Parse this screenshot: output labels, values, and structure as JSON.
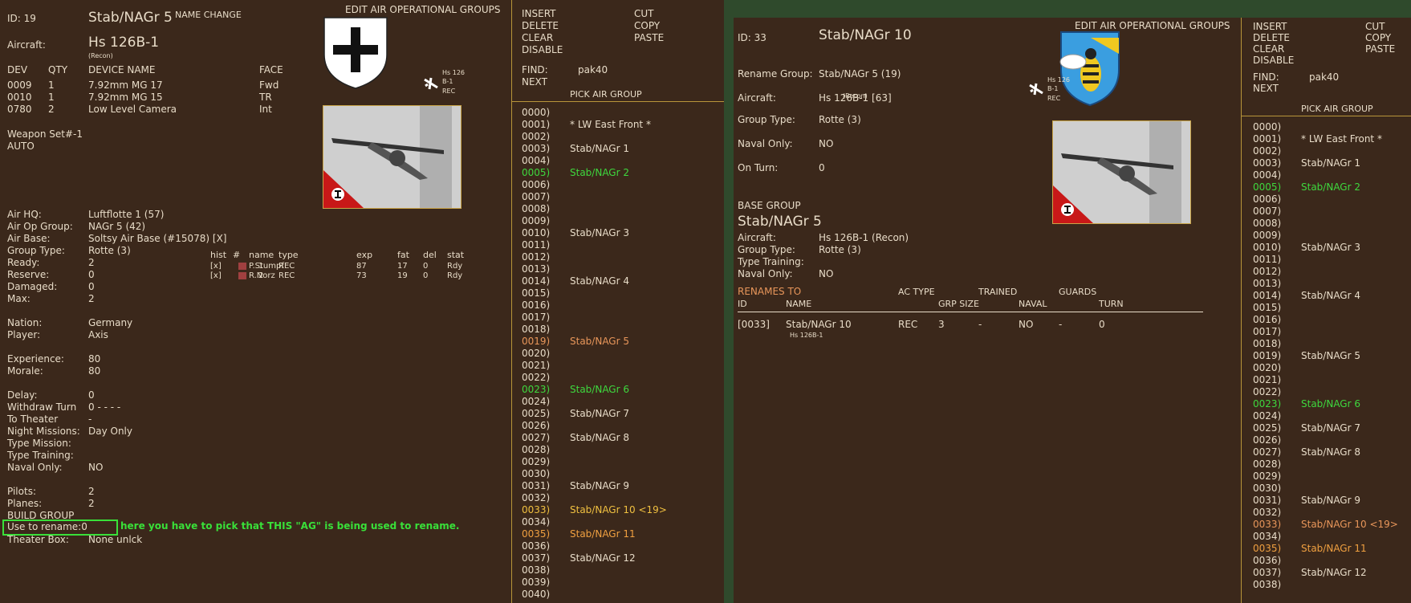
{
  "left": {
    "id": "ID: 19",
    "group_name": "Stab/NAGr 5",
    "name_change": "NAME CHANGE",
    "title": "EDIT AIR OPERATIONAL GROUPS",
    "aircraft_label": "Aircraft:",
    "aircraft": "Hs 126B-1",
    "aircraft_role": "(Recon)",
    "plane_tag1": "Hs 126",
    "plane_tag2": "B-1",
    "plane_tag3": "REC",
    "dev_headers": [
      "DEV",
      "QTY",
      "DEVICE NAME",
      "FACE"
    ],
    "devices": [
      [
        "0009",
        "1",
        "7.92mm MG 17",
        "Fwd"
      ],
      [
        "0010",
        "1",
        "7.92mm MG 15",
        "TR"
      ],
      [
        "0780",
        "2",
        "Low Level Camera",
        "Int"
      ]
    ],
    "weapon_set": "Weapon Set#-1",
    "weapon_mode": "AUTO",
    "info": [
      [
        "Air HQ:",
        "Luftflotte 1 (57)"
      ],
      [
        "Air Op Group:",
        "NAGr 5 (42)"
      ],
      [
        "Air Base:",
        "Soltsy Air Base (#15078)  [X]"
      ],
      [
        "Group Type:",
        "Rotte (3)"
      ],
      [
        "Ready:",
        "2"
      ],
      [
        "Reserve:",
        "0"
      ],
      [
        "Damaged:",
        "0"
      ],
      [
        "Max:",
        "2"
      ]
    ],
    "nation": [
      [
        "Nation:",
        "Germany"
      ],
      [
        "Player:",
        "Axis"
      ]
    ],
    "exp": [
      [
        "Experience:",
        "80"
      ],
      [
        "Morale:",
        "80"
      ]
    ],
    "timing": [
      [
        "Delay:",
        "0"
      ],
      [
        "Withdraw Turn",
        "0      -       -       -       -"
      ],
      [
        "To Theater",
        "-"
      ],
      [
        "Night Missions:",
        "Day Only"
      ],
      [
        "Type Mission:",
        ""
      ],
      [
        "Type Training:",
        ""
      ],
      [
        "Naval Only:",
        "NO"
      ]
    ],
    "pilots": [
      [
        "Pilots:",
        "2"
      ],
      [
        "Planes:",
        "2"
      ]
    ],
    "build_group": "BUILD GROUP",
    "use_to_rename": "Use to rename:0",
    "rename_hint": "here you have to pick that THIS \"AG\" is being used to rename.",
    "theater_box": "Theater Box:",
    "theater_val": "None    unlck",
    "pilot_headers": [
      "hist",
      "#",
      "name",
      "type",
      "exp",
      "fat",
      "del",
      "stat"
    ],
    "pilots_table": [
      [
        "[x]",
        "1",
        "P.Stumpf",
        "REC",
        "87",
        "17",
        "0",
        "Rdy"
      ],
      [
        "[x]",
        "2",
        "R.Norz",
        "REC",
        "73",
        "19",
        "0",
        "Rdy"
      ]
    ]
  },
  "menu_left": {
    "insert": "INSERT",
    "delete": "DELETE",
    "clear": "CLEAR",
    "disable": "DISABLE",
    "cut": "CUT",
    "copy": "COPY",
    "paste": "PASTE",
    "find_label": "FIND:",
    "find_value": "pak40",
    "next": "NEXT",
    "pick_title": "PICK AIR GROUP"
  },
  "list_left": [
    {
      "code": "0000)",
      "name": "",
      "color": "#e8dcc8"
    },
    {
      "code": "0001)",
      "name": "* LW East Front *",
      "color": "#e8dcc8"
    },
    {
      "code": "0002)",
      "name": "",
      "color": "#e8dcc8"
    },
    {
      "code": "0003)",
      "name": "Stab/NAGr 1",
      "color": "#e8dcc8"
    },
    {
      "code": "0004)",
      "name": "",
      "color": "#e8dcc8"
    },
    {
      "code": "0005)",
      "name": "Stab/NAGr 2",
      "color": "#3ed83e"
    },
    {
      "code": "0006)",
      "name": "",
      "color": "#e8dcc8"
    },
    {
      "code": "0007)",
      "name": "",
      "color": "#e8dcc8"
    },
    {
      "code": "0008)",
      "name": "",
      "color": "#e8dcc8"
    },
    {
      "code": "0009)",
      "name": "",
      "color": "#e8dcc8"
    },
    {
      "code": "0010)",
      "name": "Stab/NAGr 3",
      "color": "#e8dcc8"
    },
    {
      "code": "0011)",
      "name": "",
      "color": "#e8dcc8"
    },
    {
      "code": "0012)",
      "name": "",
      "color": "#e8dcc8"
    },
    {
      "code": "0013)",
      "name": "",
      "color": "#e8dcc8"
    },
    {
      "code": "0014)",
      "name": "Stab/NAGr 4",
      "color": "#e8dcc8"
    },
    {
      "code": "0015)",
      "name": "",
      "color": "#e8dcc8"
    },
    {
      "code": "0016)",
      "name": "",
      "color": "#e8dcc8"
    },
    {
      "code": "0017)",
      "name": "",
      "color": "#e8dcc8"
    },
    {
      "code": "0018)",
      "name": "",
      "color": "#e8dcc8"
    },
    {
      "code": "0019)",
      "name": "Stab/NAGr 5",
      "color": "#e8965a"
    },
    {
      "code": "0020)",
      "name": "",
      "color": "#e8dcc8"
    },
    {
      "code": "0021)",
      "name": "",
      "color": "#e8dcc8"
    },
    {
      "code": "0022)",
      "name": "",
      "color": "#e8dcc8"
    },
    {
      "code": "0023)",
      "name": "Stab/NAGr 6",
      "color": "#3ed83e"
    },
    {
      "code": "0024)",
      "name": "",
      "color": "#e8dcc8"
    },
    {
      "code": "0025)",
      "name": "Stab/NAGr 7",
      "color": "#e8dcc8"
    },
    {
      "code": "0026)",
      "name": "",
      "color": "#e8dcc8"
    },
    {
      "code": "0027)",
      "name": "Stab/NAGr 8",
      "color": "#e8dcc8"
    },
    {
      "code": "0028)",
      "name": "",
      "color": "#e8dcc8"
    },
    {
      "code": "0029)",
      "name": "",
      "color": "#e8dcc8"
    },
    {
      "code": "0030)",
      "name": "",
      "color": "#e8dcc8"
    },
    {
      "code": "0031)",
      "name": "Stab/NAGr 9",
      "color": "#e8dcc8"
    },
    {
      "code": "0032)",
      "name": "",
      "color": "#e8dcc8"
    },
    {
      "code": "0033)",
      "name": "Stab/NAGr 10 <19>",
      "color": "#f0c040"
    },
    {
      "code": "0034)",
      "name": "",
      "color": "#e8dcc8"
    },
    {
      "code": "0035)",
      "name": "Stab/NAGr 11",
      "color": "#f0a040"
    },
    {
      "code": "0036)",
      "name": "",
      "color": "#e8dcc8"
    },
    {
      "code": "0037)",
      "name": "Stab/NAGr 12",
      "color": "#e8dcc8"
    },
    {
      "code": "0038)",
      "name": "",
      "color": "#e8dcc8"
    },
    {
      "code": "0039)",
      "name": "",
      "color": "#e8dcc8"
    },
    {
      "code": "0040)",
      "name": "",
      "color": "#e8dcc8"
    }
  ],
  "right": {
    "id": "ID: 33",
    "group_name": "Stab/NAGr 10",
    "title": "EDIT AIR OPERATIONAL GROUPS",
    "info": [
      [
        "Rename Group:",
        "Stab/NAGr 5 (19)"
      ],
      [
        "Aircraft:",
        "Hs 126B-1 [63]"
      ]
    ],
    "aircraft_role": "(Recon)",
    "info2": [
      [
        "Group Type:",
        "Rotte (3)"
      ],
      [
        "Naval Only:",
        "NO"
      ],
      [
        "On Turn:",
        "0"
      ]
    ],
    "plane_tag1": "Hs 126",
    "plane_tag2": "B-1",
    "plane_tag3": "REC",
    "base_group_label": "BASE GROUP",
    "base_group_name": "Stab/NAGr 5",
    "base_info": [
      [
        "Aircraft:",
        "Hs 126B-1 (Recon)"
      ],
      [
        "Group Type:",
        "Rotte (3)"
      ],
      [
        "Type Training:",
        ""
      ],
      [
        "Naval Only:",
        "NO"
      ]
    ],
    "renames_to": "RENAMES TO",
    "rh1": {
      "actype": "AC TYPE",
      "trained": "TRAINED",
      "guards": "GUARDS"
    },
    "rh2": {
      "id": "ID",
      "name": "NAME",
      "grp": "GRP SIZE",
      "naval": "NAVAL",
      "turn": "TURN"
    },
    "rename_row": {
      "id": "[0033]",
      "name": "Stab/NAGr 10",
      "actype": "REC",
      "grp": "3",
      "trained": "-",
      "naval": "NO",
      "guards": "-",
      "turn": "0",
      "sub": "Hs 126B-1"
    }
  },
  "menu_right": {
    "insert": "INSERT",
    "delete": "DELETE",
    "clear": "CLEAR",
    "disable": "DISABLE",
    "cut": "CUT",
    "copy": "COPY",
    "paste": "PASTE",
    "find_label": "FIND:",
    "find_value": "pak40",
    "next": "NEXT",
    "pick_title": "PICK AIR GROUP"
  },
  "list_right": [
    {
      "code": "0000)",
      "name": "",
      "color": "#e8dcc8"
    },
    {
      "code": "0001)",
      "name": "* LW East Front *",
      "color": "#e8dcc8"
    },
    {
      "code": "0002)",
      "name": "",
      "color": "#e8dcc8"
    },
    {
      "code": "0003)",
      "name": "Stab/NAGr 1",
      "color": "#e8dcc8"
    },
    {
      "code": "0004)",
      "name": "",
      "color": "#e8dcc8"
    },
    {
      "code": "0005)",
      "name": "Stab/NAGr 2",
      "color": "#3ed83e"
    },
    {
      "code": "0006)",
      "name": "",
      "color": "#e8dcc8"
    },
    {
      "code": "0007)",
      "name": "",
      "color": "#e8dcc8"
    },
    {
      "code": "0008)",
      "name": "",
      "color": "#e8dcc8"
    },
    {
      "code": "0009)",
      "name": "",
      "color": "#e8dcc8"
    },
    {
      "code": "0010)",
      "name": "Stab/NAGr 3",
      "color": "#e8dcc8"
    },
    {
      "code": "0011)",
      "name": "",
      "color": "#e8dcc8"
    },
    {
      "code": "0012)",
      "name": "",
      "color": "#e8dcc8"
    },
    {
      "code": "0013)",
      "name": "",
      "color": "#e8dcc8"
    },
    {
      "code": "0014)",
      "name": "Stab/NAGr 4",
      "color": "#e8dcc8"
    },
    {
      "code": "0015)",
      "name": "",
      "color": "#e8dcc8"
    },
    {
      "code": "0016)",
      "name": "",
      "color": "#e8dcc8"
    },
    {
      "code": "0017)",
      "name": "",
      "color": "#e8dcc8"
    },
    {
      "code": "0018)",
      "name": "",
      "color": "#e8dcc8"
    },
    {
      "code": "0019)",
      "name": "Stab/NAGr 5",
      "color": "#e8dcc8"
    },
    {
      "code": "0020)",
      "name": "",
      "color": "#e8dcc8"
    },
    {
      "code": "0021)",
      "name": "",
      "color": "#e8dcc8"
    },
    {
      "code": "0022)",
      "name": "",
      "color": "#e8dcc8"
    },
    {
      "code": "0023)",
      "name": "Stab/NAGr 6",
      "color": "#3ed83e"
    },
    {
      "code": "0024)",
      "name": "",
      "color": "#e8dcc8"
    },
    {
      "code": "0025)",
      "name": "Stab/NAGr 7",
      "color": "#e8dcc8"
    },
    {
      "code": "0026)",
      "name": "",
      "color": "#e8dcc8"
    },
    {
      "code": "0027)",
      "name": "Stab/NAGr 8",
      "color": "#e8dcc8"
    },
    {
      "code": "0028)",
      "name": "",
      "color": "#e8dcc8"
    },
    {
      "code": "0029)",
      "name": "",
      "color": "#e8dcc8"
    },
    {
      "code": "0030)",
      "name": "",
      "color": "#e8dcc8"
    },
    {
      "code": "0031)",
      "name": "Stab/NAGr 9",
      "color": "#e8dcc8"
    },
    {
      "code": "0032)",
      "name": "",
      "color": "#e8dcc8"
    },
    {
      "code": "0033)",
      "name": "Stab/NAGr 10 <19>",
      "color": "#e8965a"
    },
    {
      "code": "0034)",
      "name": "",
      "color": "#e8dcc8"
    },
    {
      "code": "0035)",
      "name": "Stab/NAGr 11",
      "color": "#f0a040"
    },
    {
      "code": "0036)",
      "name": "",
      "color": "#e8dcc8"
    },
    {
      "code": "0037)",
      "name": "Stab/NAGr 12",
      "color": "#e8dcc8"
    },
    {
      "code": "0038)",
      "name": "",
      "color": "#e8dcc8"
    }
  ],
  "colors": {
    "panel": "#3b281b",
    "text": "#e8dcc8",
    "orange": "#e8965a",
    "green": "#3ed83e",
    "yellow": "#f0c040",
    "gold_line": "#b8953a",
    "hint_green": "#39e039"
  }
}
